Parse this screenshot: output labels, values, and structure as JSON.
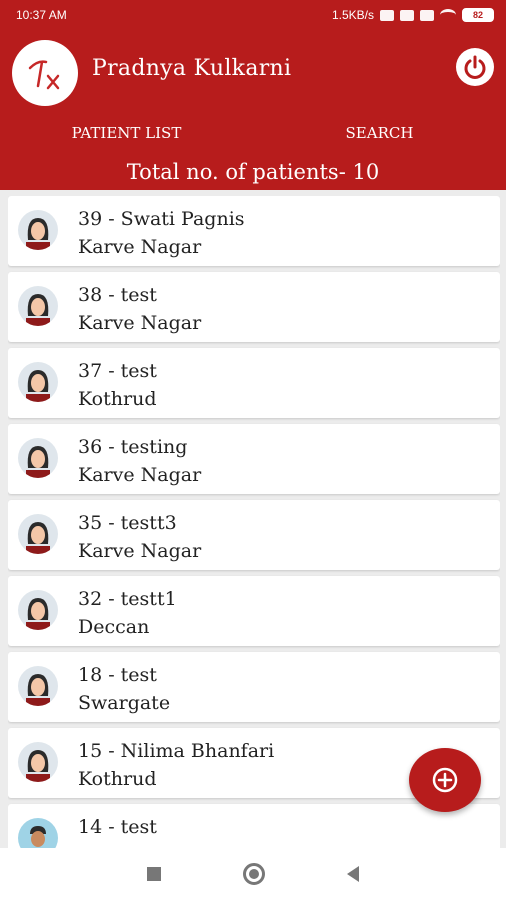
{
  "status_bar": {
    "time": "10:37 AM",
    "network_speed": "1.5KB/s",
    "battery": "82",
    "icons": [
      "data-saver-icon",
      "alarm-icon",
      "signal-icon",
      "wifi-icon",
      "battery-icon"
    ]
  },
  "header": {
    "logo_icon": "rx-logo-icon",
    "doctor_name": "Pradnya Kulkarni",
    "power_icon": "power-icon"
  },
  "tabs": [
    {
      "label": "PATIENT LIST"
    },
    {
      "label": "SEARCH"
    }
  ],
  "total_label": "Total no. of patients- 10",
  "patients": [
    {
      "title": "39 - Swati Pagnis",
      "area": "Karve Nagar",
      "avatar": "female-avatar-icon"
    },
    {
      "title": "38 - test",
      "area": "Karve Nagar",
      "avatar": "female-avatar-icon"
    },
    {
      "title": "37 - test",
      "area": "Kothrud",
      "avatar": "female-avatar-icon"
    },
    {
      "title": "36 - testing",
      "area": "Karve Nagar",
      "avatar": "female-avatar-icon"
    },
    {
      "title": "35 - testt3",
      "area": "Karve Nagar",
      "avatar": "female-avatar-icon"
    },
    {
      "title": "32 - testt1",
      "area": "Deccan",
      "avatar": "female-avatar-icon"
    },
    {
      "title": "18 - test",
      "area": "Swargate",
      "avatar": "female-avatar-icon"
    },
    {
      "title": "15 - Nilima Bhanfari",
      "area": "Kothrud",
      "avatar": "female-avatar-icon"
    },
    {
      "title": "14 - test",
      "area": "",
      "avatar": "male-avatar-icon"
    }
  ],
  "fab_icon": "add-circle-icon",
  "colors": {
    "primary": "#b71c1c",
    "background": "#ececec"
  }
}
